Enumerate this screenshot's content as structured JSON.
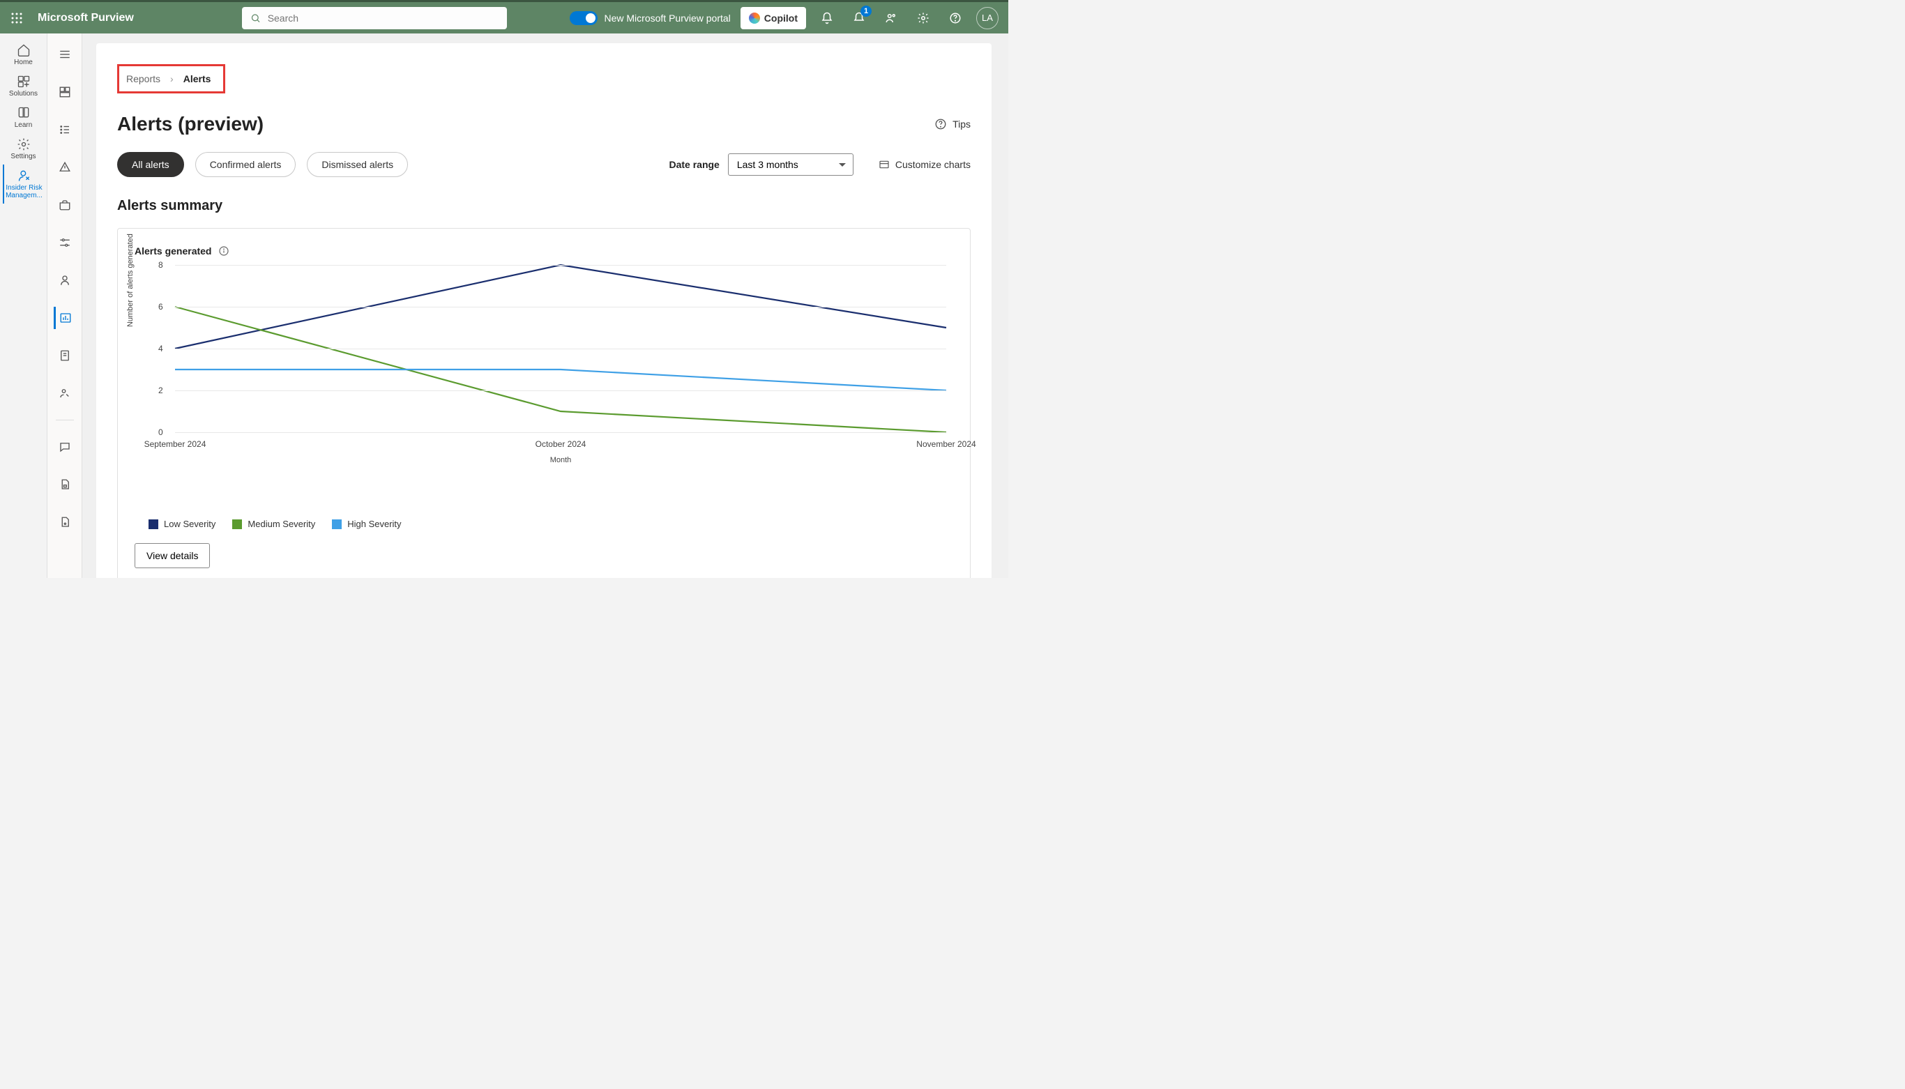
{
  "header": {
    "app_name": "Microsoft Purview",
    "search_placeholder": "Search",
    "toggle_label": "New Microsoft Purview portal",
    "copilot_label": "Copilot",
    "notification_badge": "1",
    "avatar_initials": "LA"
  },
  "rail1": {
    "items": [
      {
        "label": "Home"
      },
      {
        "label": "Solutions"
      },
      {
        "label": "Learn"
      },
      {
        "label": "Settings"
      },
      {
        "label": "Insider Risk Managem..."
      }
    ]
  },
  "breadcrumb": {
    "parent": "Reports",
    "current": "Alerts"
  },
  "page": {
    "title": "Alerts (preview)",
    "tips_label": "Tips",
    "pills": [
      "All alerts",
      "Confirmed alerts",
      "Dismissed alerts"
    ],
    "date_range_label": "Date range",
    "date_range_value": "Last 3 months",
    "customize_label": "Customize charts",
    "section_title": "Alerts summary",
    "chart_title": "Alerts generated",
    "view_details_label": "View details"
  },
  "chart_data": {
    "type": "line",
    "title": "Alerts generated",
    "xlabel": "Month",
    "ylabel": "Number of alerts generated",
    "ylim": [
      0,
      8
    ],
    "yticks": [
      0,
      2,
      4,
      6,
      8
    ],
    "categories": [
      "September 2024",
      "October 2024",
      "November 2024"
    ],
    "series": [
      {
        "name": "Low Severity",
        "color": "#1a2e6e",
        "values": [
          4,
          8,
          5
        ]
      },
      {
        "name": "Medium Severity",
        "color": "#5b9b2f",
        "values": [
          6,
          1,
          0
        ]
      },
      {
        "name": "High Severity",
        "color": "#3fa0e6",
        "values": [
          3,
          3,
          2
        ]
      }
    ]
  }
}
